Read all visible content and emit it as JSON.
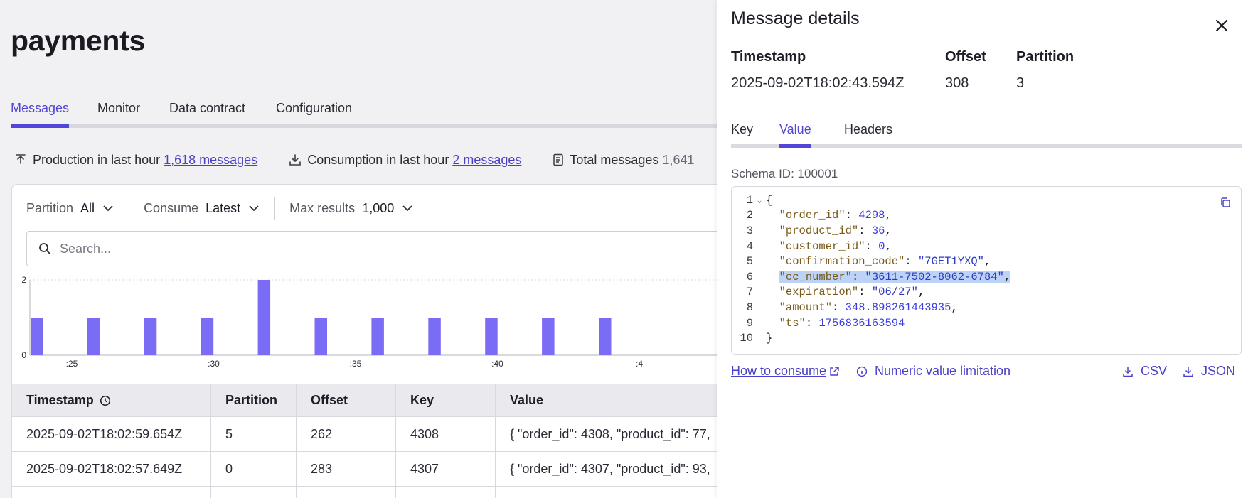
{
  "page": {
    "title": "payments"
  },
  "tabs": [
    "Messages",
    "Monitor",
    "Data contract",
    "Configuration"
  ],
  "stats": {
    "production_label": "Production in last hour",
    "production_value": "1,618 messages",
    "consumption_label": "Consumption in last hour",
    "consumption_value": "2 messages",
    "total_label": "Total messages",
    "total_value": "1,641"
  },
  "filters": {
    "partition_label": "Partition",
    "partition_value": "All",
    "consume_label": "Consume",
    "consume_value": "Latest",
    "max_label": "Max results",
    "max_value": "1,000"
  },
  "search": {
    "placeholder": "Search..."
  },
  "chart_data": {
    "type": "bar",
    "ylim": [
      0,
      2
    ],
    "y_ticks": [
      "2",
      "0"
    ],
    "x_tick_labels": [
      ":25",
      ":30",
      ":35",
      ":40",
      ":4"
    ],
    "values": [
      1,
      1,
      1,
      1,
      2,
      1,
      1,
      1,
      1,
      1,
      1
    ],
    "color": "#7b6cf6"
  },
  "table": {
    "headers": [
      "Timestamp",
      "Partition",
      "Offset",
      "Key",
      "Value"
    ],
    "rows": [
      [
        "2025-09-02T18:02:59.654Z",
        "5",
        "262",
        "4308",
        "{ \"order_id\": 4308, \"product_id\": 77,"
      ],
      [
        "2025-09-02T18:02:57.649Z",
        "0",
        "283",
        "4307",
        "{ \"order_id\": 4307, \"product_id\": 93,"
      ]
    ]
  },
  "drawer": {
    "title": "Message details",
    "meta": {
      "timestamp_label": "Timestamp",
      "timestamp_value": "2025-09-02T18:02:43.594Z",
      "offset_label": "Offset",
      "offset_value": "308",
      "partition_label": "Partition",
      "partition_value": "3"
    },
    "tabs": [
      "Key",
      "Value",
      "Headers"
    ],
    "schema": "Schema ID: 100001",
    "code": {
      "l1": "{",
      "k_order": "\"order_id\"",
      "v_order": "4298",
      "k_product": "\"product_id\"",
      "v_product": "36",
      "k_customer": "\"customer_id\"",
      "v_customer": "0",
      "k_conf": "\"confirmation_code\"",
      "v_conf": "\"7GET1YXQ\"",
      "k_cc": "\"cc_number\"",
      "v_cc": "\"3611-7502-8062-6784\"",
      "k_exp": "\"expiration\"",
      "v_exp": "\"06/27\"",
      "k_amount": "\"amount\"",
      "v_amount": "348.898261443935",
      "k_ts": "\"ts\"",
      "v_ts": "1756836163594",
      "l10": "}"
    },
    "links": {
      "how": "How to consume",
      "numeric": "Numeric value limitation",
      "csv": "CSV",
      "json": "JSON"
    }
  },
  "colors": {
    "accent": "#5146d6",
    "bar": "#7b6cf6"
  }
}
